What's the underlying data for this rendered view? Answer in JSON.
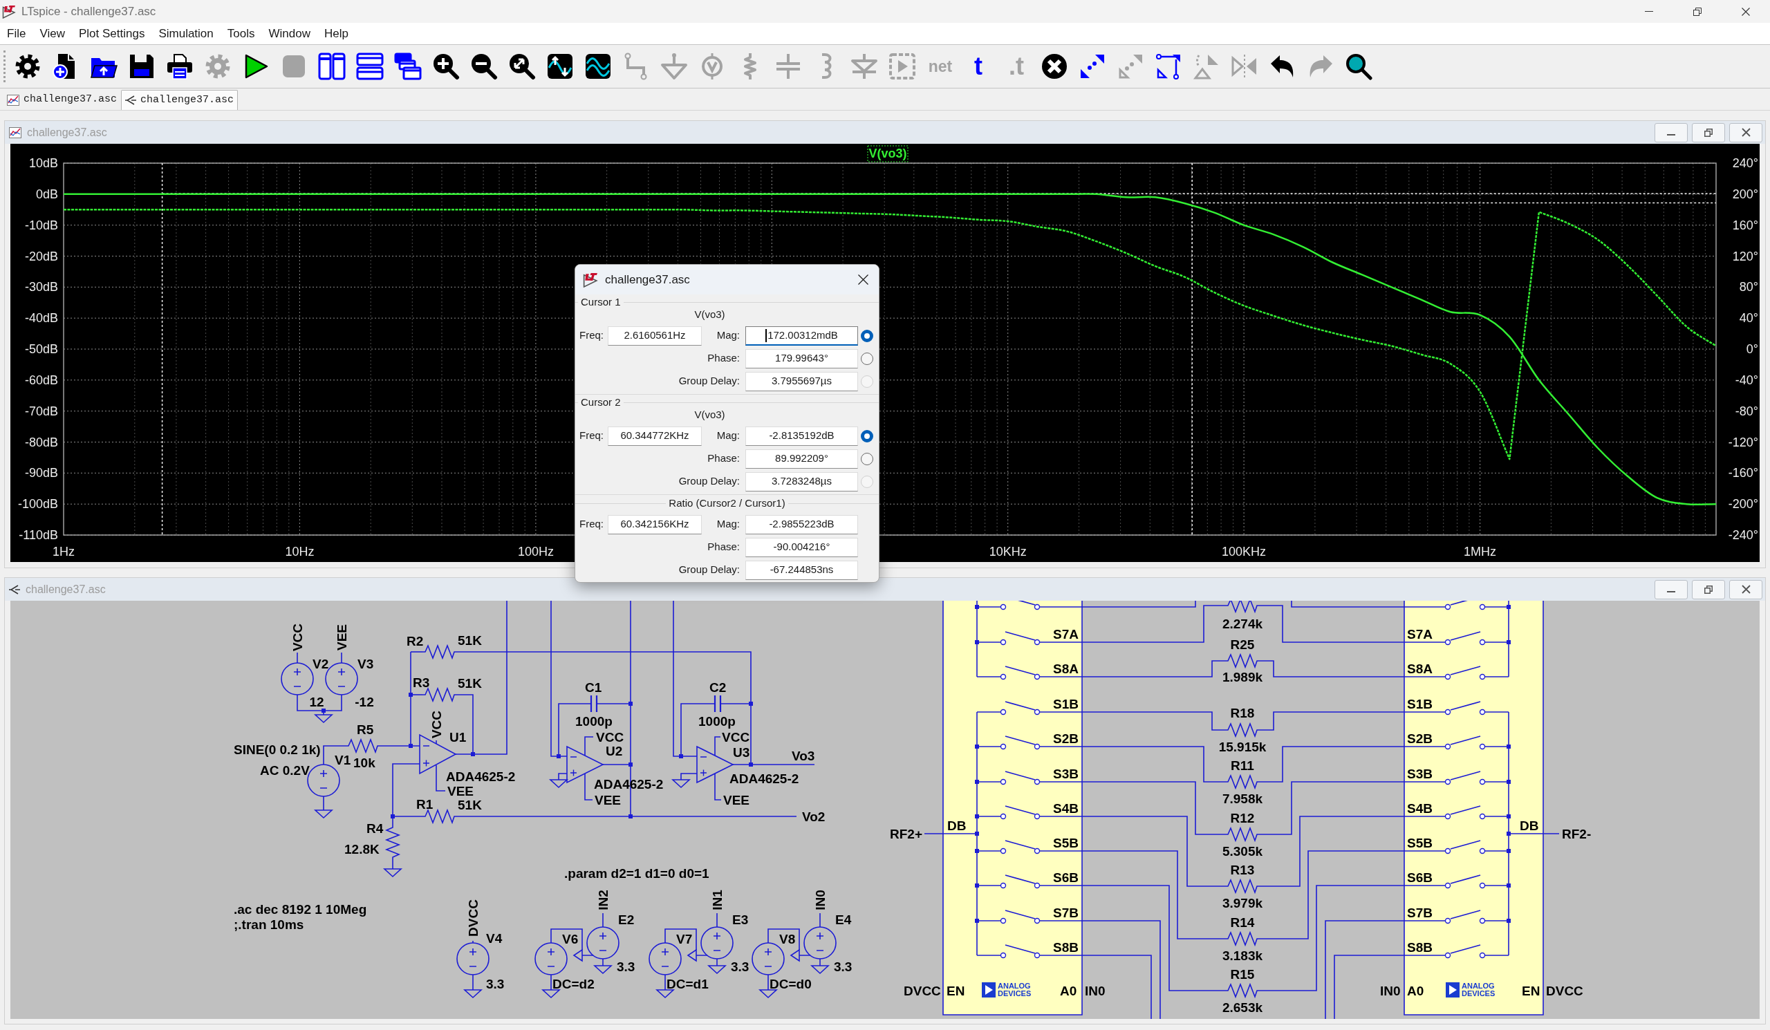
{
  "window": {
    "title": "LTspice - challenge37.asc"
  },
  "menu": [
    "File",
    "View",
    "Plot Settings",
    "Simulation",
    "Tools",
    "Window",
    "Help"
  ],
  "toolbar": [
    {
      "kind": "gear",
      "disabled": false
    },
    {
      "kind": "new",
      "disabled": false
    },
    {
      "kind": "open",
      "disabled": false
    },
    {
      "kind": "save",
      "disabled": false
    },
    {
      "kind": "print",
      "disabled": false
    },
    {
      "kind": "gear",
      "disabled": true
    },
    {
      "kind": "run",
      "disabled": false
    },
    {
      "kind": "stop",
      "disabled": true
    },
    {
      "kind": "tile_vertical",
      "disabled": false
    },
    {
      "kind": "tile_horizontal",
      "disabled": false
    },
    {
      "kind": "cascade",
      "disabled": false
    },
    {
      "kind": "zoom_in",
      "disabled": false
    },
    {
      "kind": "zoom_out",
      "disabled": false
    },
    {
      "kind": "zoom_fit",
      "disabled": false
    },
    {
      "kind": "autoscale",
      "disabled": false
    },
    {
      "kind": "waveform",
      "disabled": false
    },
    {
      "kind": "wire",
      "disabled": true
    },
    {
      "kind": "ground",
      "disabled": true
    },
    {
      "kind": "source",
      "disabled": true
    },
    {
      "kind": "resistor",
      "disabled": true
    },
    {
      "kind": "capacitor",
      "disabled": true
    },
    {
      "kind": "inductor",
      "disabled": true
    },
    {
      "kind": "diode",
      "disabled": true
    },
    {
      "kind": "component",
      "disabled": true
    },
    {
      "kind": "net",
      "label": "net",
      "disabled": true
    },
    {
      "kind": "text",
      "label": "t",
      "disabled": false
    },
    {
      "kind": "directive",
      "label": ".t",
      "disabled": true
    },
    {
      "kind": "delete",
      "disabled": false
    },
    {
      "kind": "duplicate",
      "disabled": false
    },
    {
      "kind": "move",
      "disabled": true
    },
    {
      "kind": "drag",
      "disabled": false
    },
    {
      "kind": "rotate",
      "disabled": true
    },
    {
      "kind": "mirror",
      "disabled": true
    },
    {
      "kind": "undo",
      "disabled": false
    },
    {
      "kind": "redo",
      "disabled": true
    },
    {
      "kind": "find",
      "disabled": false
    }
  ],
  "tabs": [
    {
      "kind": "plot",
      "label": "challenge37.asc",
      "selected": false
    },
    {
      "kind": "schematic",
      "label": "challenge37.asc",
      "selected": true
    }
  ],
  "plot_window": {
    "title": "challenge37.asc",
    "chart_data": {
      "type": "line",
      "title": "V(vo3)",
      "grid": true,
      "categories": [
        "1Hz",
        null,
        null,
        null,
        null,
        null,
        null,
        null,
        "10Hz",
        null,
        null,
        null,
        null,
        null,
        null,
        null,
        "100Hz",
        null,
        null,
        null,
        null,
        null,
        null,
        null,
        null,
        null,
        null,
        null,
        null,
        null,
        null,
        null,
        "10KHz",
        null,
        null,
        null,
        null,
        null,
        null,
        null,
        "100KHz",
        null,
        null,
        null,
        null,
        null,
        null,
        null,
        "1MHz",
        null,
        null,
        null,
        null,
        null,
        null,
        null,
        null
      ],
      "series": [
        {
          "color": "#33ee33",
          "values": [
            0,
            0,
            0,
            0,
            0,
            0,
            0,
            0,
            0,
            0,
            0,
            0,
            0,
            0,
            0,
            0,
            0,
            0,
            0,
            0,
            0,
            0,
            0,
            0,
            0,
            0,
            0,
            0,
            0,
            0,
            0,
            0,
            0,
            0,
            0,
            0,
            -1,
            -1,
            -3,
            -6,
            -10,
            -13,
            -17,
            -22,
            -26,
            -30,
            -34,
            -38,
            -39,
            -46,
            -60,
            -71,
            -82,
            -91,
            -98,
            -100,
            -100
          ]
        },
        {
          "axis": "y2",
          "color": "#33ee33",
          "line_style": "dashed",
          "values": [
            180,
            180,
            180,
            180,
            180,
            180,
            180,
            180,
            180,
            180,
            180,
            180,
            180,
            180,
            180,
            180,
            180,
            180,
            180,
            180,
            180,
            180,
            179,
            179,
            178,
            177,
            176,
            175,
            174,
            172,
            170,
            167,
            165,
            158,
            152,
            139,
            124,
            107,
            93,
            73,
            56,
            43,
            31,
            21,
            12,
            4,
            -7,
            -19,
            -55,
            -142,
            177,
            162,
            141,
            108,
            69,
            29,
            4
          ]
        }
      ],
      "ylim": [
        -110,
        10
      ],
      "y2lim": [
        -240,
        240
      ],
      "yticks": [
        {
          "value": 10,
          "label": "10dB"
        },
        {
          "value": 0,
          "label": "0dB"
        },
        {
          "value": -10,
          "label": "-10dB"
        },
        {
          "value": -20,
          "label": "-20dB"
        },
        {
          "value": -30,
          "label": "-30dB"
        },
        {
          "value": -40,
          "label": "-40dB"
        },
        {
          "value": -50,
          "label": "-50dB"
        },
        {
          "value": -60,
          "label": "-60dB"
        },
        {
          "value": -70,
          "label": "-70dB"
        },
        {
          "value": -80,
          "label": "-80dB"
        },
        {
          "value": -90,
          "label": "-90dB"
        },
        {
          "value": -100,
          "label": "-100dB"
        },
        {
          "value": -110,
          "label": "-110dB"
        }
      ],
      "y2ticks": [
        {
          "value": 240,
          "label": "240°"
        },
        {
          "value": 200,
          "label": "200°"
        },
        {
          "value": 160,
          "label": "160°"
        },
        {
          "value": 120,
          "label": "120°"
        },
        {
          "value": 80,
          "label": "80°"
        },
        {
          "value": 40,
          "label": "40°"
        },
        {
          "value": 0,
          "label": "0°"
        },
        {
          "value": -40,
          "label": "-40°"
        },
        {
          "value": -80,
          "label": "-80°"
        },
        {
          "value": -120,
          "label": "-120°"
        },
        {
          "value": -160,
          "label": "-160°"
        },
        {
          "value": -200,
          "label": "-200°"
        },
        {
          "value": -240,
          "label": "-240°"
        }
      ]
    }
  },
  "schematic_window": {
    "title": "challenge37.asc",
    "components": [
      {
        "kind": "voltage_source",
        "name": "V2",
        "value": "12"
      },
      {
        "kind": "voltage_source",
        "name": "V3",
        "value": "-12"
      },
      {
        "kind": "resistor",
        "name": "R2",
        "value": "51K"
      },
      {
        "kind": "resistor",
        "name": "R3",
        "value": "51K"
      },
      {
        "kind": "resistor",
        "name": "R5",
        "value": "10k"
      },
      {
        "kind": "voltage_source",
        "name": "V1",
        "value": "SINE(0 0.2 1k)",
        "value2": "AC 0.2V"
      },
      {
        "kind": "opamp",
        "name": "U1",
        "value": "ADA4625-2"
      },
      {
        "kind": "resistor",
        "name": "R1",
        "value": "51K"
      },
      {
        "kind": "resistor",
        "name": "R4",
        "value": "12.8K"
      },
      {
        "kind": "capacitor",
        "name": "C1",
        "value": "1000p"
      },
      {
        "kind": "opamp",
        "name": "U2",
        "value": "ADA4625-2"
      },
      {
        "kind": "capacitor",
        "name": "C2",
        "value": "1000p"
      },
      {
        "kind": "opamp",
        "name": "U3",
        "value": "ADA4625-2"
      },
      {
        "kind": "voltage_source",
        "name": "V4",
        "value": "3.3"
      },
      {
        "kind": "voltage_source",
        "name": "V6",
        "value": "DC=d2"
      },
      {
        "kind": "controlled_source",
        "name": "E2",
        "value": "3.3"
      },
      {
        "kind": "voltage_source",
        "name": "V7",
        "value": "DC=d1"
      },
      {
        "kind": "controlled_source",
        "name": "E3",
        "value": "3.3"
      },
      {
        "kind": "voltage_source",
        "name": "V8",
        "value": "DC=d0"
      },
      {
        "kind": "controlled_source",
        "name": "E4",
        "value": "3.3"
      },
      {
        "kind": "resistor",
        "value": "2.274k"
      },
      {
        "kind": "resistor",
        "name": "R25",
        "value": "1.989k"
      },
      {
        "kind": "resistor",
        "name": "R18",
        "value": "15.915k"
      },
      {
        "kind": "resistor",
        "name": "R11",
        "value": "7.958k"
      },
      {
        "kind": "resistor",
        "name": "R12",
        "value": "5.305k"
      },
      {
        "kind": "resistor",
        "name": "R13",
        "value": "3.979k"
      },
      {
        "kind": "resistor",
        "name": "R14",
        "value": "3.183k"
      },
      {
        "kind": "resistor",
        "name": "R15",
        "value": "2.653k"
      }
    ],
    "net_labels": [
      "VCC",
      "VEE",
      "VCC",
      "VEE",
      "VCC",
      "VEE",
      "VCC",
      "VEE",
      "Vo3",
      "Vo2",
      "DVCC",
      "IN2",
      "IN1",
      "IN0",
      "RF2+",
      "DVCC",
      "IN0",
      "IN0",
      "DVCC",
      "RF2-"
    ],
    "directives": [
      ".param d2=1 d1=0 d0=1",
      ".ac dec 8192 1 10Meg",
      ";.tran 10ms"
    ],
    "switch_ics": [
      {
        "mirrored": false,
        "pins": [
          "S7A",
          "S8A",
          "S1B",
          "S2B",
          "S3B",
          "S4B",
          "S5B",
          "S6B",
          "S7B",
          "S8B"
        ],
        "common_pin": "DB",
        "enable_pin": "EN",
        "address_pin": "A0",
        "logo": [
          "ANALOG",
          "DEVICES"
        ]
      },
      {
        "mirrored": true,
        "pins": [
          "S7A",
          "S8A",
          "S1B",
          "S2B",
          "S3B",
          "S4B",
          "S5B",
          "S6B",
          "S7B",
          "S8B"
        ],
        "common_pin": "DB",
        "enable_pin": "EN",
        "address_pin": "A0",
        "logo": [
          "ANALOG",
          "DEVICES"
        ]
      }
    ]
  },
  "cursor_dialog": {
    "title": "challenge37.asc",
    "groups": [
      {
        "kind": "cursor",
        "title": "Cursor 1",
        "trace": "V(vo3)",
        "freq_label": "Freq:",
        "freq": "2.6160561Hz",
        "rows": [
          {
            "label": "Mag:",
            "value": "172.00312mdB",
            "selected": true,
            "disabled": false,
            "focused": true
          },
          {
            "label": "Phase:",
            "value": "179.99643°",
            "selected": false,
            "disabled": false,
            "focused": false
          },
          {
            "label": "Group Delay:",
            "value": "3.7955697µs",
            "selected": false,
            "disabled": true,
            "focused": false
          }
        ]
      },
      {
        "kind": "cursor",
        "title": "Cursor 2",
        "trace": "V(vo3)",
        "freq_label": "Freq:",
        "freq": "60.344772KHz",
        "rows": [
          {
            "label": "Mag:",
            "value": "-2.8135192dB",
            "selected": true,
            "disabled": false,
            "focused": false
          },
          {
            "label": "Phase:",
            "value": "89.992209°",
            "selected": false,
            "disabled": false,
            "focused": false
          },
          {
            "label": "Group Delay:",
            "value": "3.7283248µs",
            "selected": false,
            "disabled": true,
            "focused": false
          }
        ]
      },
      {
        "kind": "ratio",
        "title": "Ratio (Cursor2 / Cursor1)",
        "freq_label": "Freq:",
        "freq": "60.342156KHz",
        "rows": [
          {
            "label": "Mag:",
            "value": "-2.9855223dB",
            "focused": false
          },
          {
            "label": "Phase:",
            "value": "-90.004216°",
            "focused": false
          },
          {
            "label": "Group Delay:",
            "value": "-67.244853ns",
            "focused": false
          }
        ]
      }
    ]
  }
}
